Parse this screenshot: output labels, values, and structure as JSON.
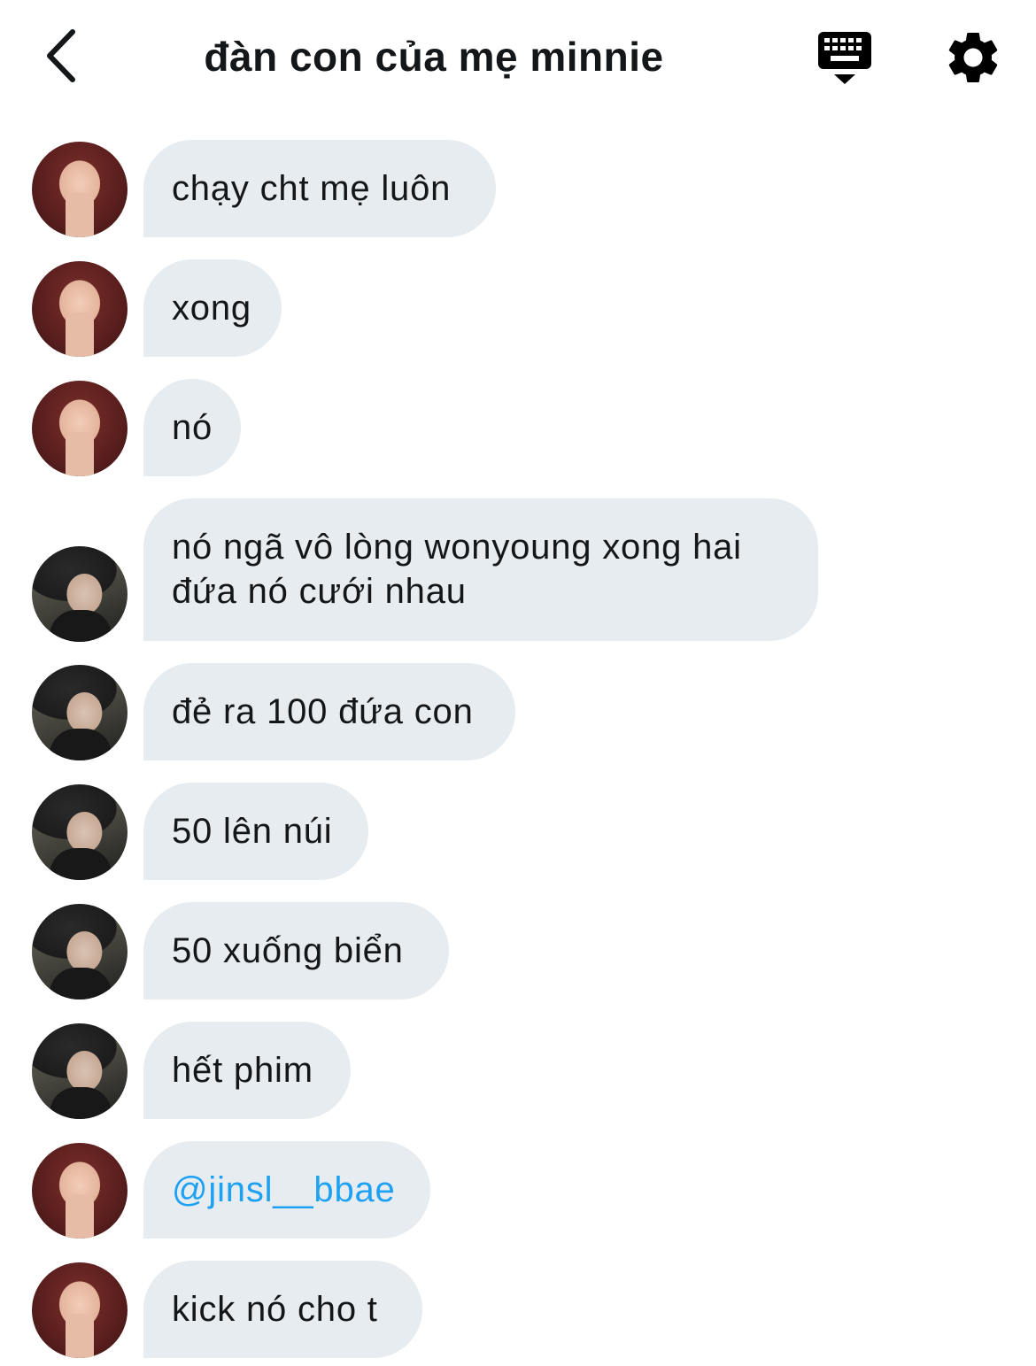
{
  "header": {
    "title": "đàn con của mẹ minnie"
  },
  "messages": [
    {
      "text": "chạy cht mẹ luôn",
      "avatar": "a"
    },
    {
      "text": "xong",
      "avatar": "a"
    },
    {
      "text": "nó",
      "avatar": "a"
    },
    {
      "text": "nó ngã vô lòng wonyoung xong hai đứa nó cưới nhau",
      "avatar": "b"
    },
    {
      "text": "đẻ ra 100 đứa con",
      "avatar": "b"
    },
    {
      "text": "50 lên núi",
      "avatar": "b"
    },
    {
      "text": "50 xuống biển",
      "avatar": "b"
    },
    {
      "text": "hết phim",
      "avatar": "b"
    },
    {
      "text": "@jinsl__bbae",
      "avatar": "a",
      "mention": true
    },
    {
      "text": "kick nó cho t",
      "avatar": "a"
    }
  ],
  "colors": {
    "bubble": "#e6ecf0",
    "mention": "#1da1f2",
    "text": "#14171a"
  }
}
